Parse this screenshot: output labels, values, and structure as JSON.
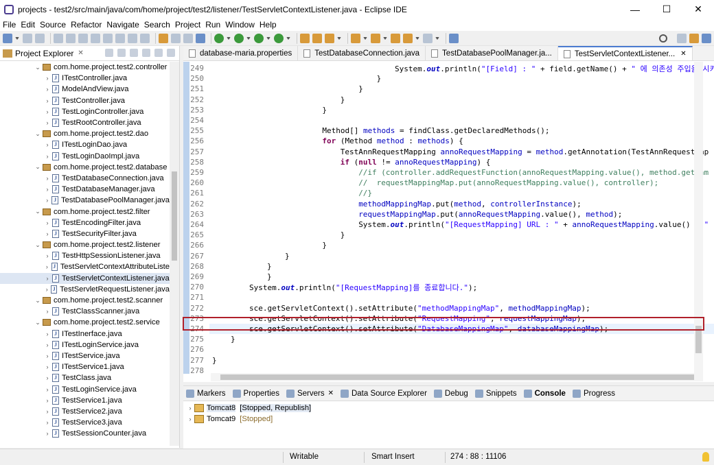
{
  "window": {
    "title": "projects - test2/src/main/java/com/home/project/test2/listener/TestServletContextListener.java - Eclipse IDE",
    "minimize": "—",
    "maximize": "☐",
    "close": "✕"
  },
  "menu": [
    "File",
    "Edit",
    "Source",
    "Refactor",
    "Navigate",
    "Search",
    "Project",
    "Run",
    "Window",
    "Help"
  ],
  "project_explorer": {
    "title": "Project Explorer",
    "close": "✕",
    "items": [
      {
        "type": "pkg",
        "label": "com.home.project.test2.controller"
      },
      {
        "type": "java",
        "label": "ITestController.java"
      },
      {
        "type": "java",
        "label": "ModelAndView.java"
      },
      {
        "type": "java",
        "label": "TestController.java"
      },
      {
        "type": "java",
        "label": "TestLoginController.java"
      },
      {
        "type": "java",
        "label": "TestRootController.java"
      },
      {
        "type": "pkg",
        "label": "com.home.project.test2.dao"
      },
      {
        "type": "java",
        "label": "ITestLoginDao.java"
      },
      {
        "type": "java",
        "label": "TestLoginDaoImpl.java"
      },
      {
        "type": "pkg",
        "label": "com.home.project.test2.database"
      },
      {
        "type": "java",
        "label": "TestDatabaseConnection.java"
      },
      {
        "type": "java",
        "label": "TestDatabaseManager.java"
      },
      {
        "type": "java",
        "label": "TestDatabasePoolManager.java"
      },
      {
        "type": "pkg",
        "label": "com.home.project.test2.filter"
      },
      {
        "type": "java",
        "label": "TestEncodingFilter.java"
      },
      {
        "type": "java",
        "label": "TestSecurityFilter.java"
      },
      {
        "type": "pkg",
        "label": "com.home.project.test2.listener"
      },
      {
        "type": "java",
        "label": "TestHttpSessionListener.java"
      },
      {
        "type": "java",
        "label": "TestServletContextAttributeListe"
      },
      {
        "type": "java",
        "label": "TestServletContextListener.java",
        "selected": true
      },
      {
        "type": "java",
        "label": "TestServletRequestListener.java"
      },
      {
        "type": "pkg",
        "label": "com.home.project.test2.scanner"
      },
      {
        "type": "java",
        "label": "TestClassScanner.java"
      },
      {
        "type": "pkg",
        "label": "com.home.project.test2.service"
      },
      {
        "type": "java",
        "label": "ITestInerface.java"
      },
      {
        "type": "java",
        "label": "ITestLoginService.java"
      },
      {
        "type": "java",
        "label": "ITestService.java"
      },
      {
        "type": "java",
        "label": "ITestService1.java"
      },
      {
        "type": "java",
        "label": "TestClass.java"
      },
      {
        "type": "java",
        "label": "TestLoginService.java"
      },
      {
        "type": "java",
        "label": "TestService1.java"
      },
      {
        "type": "java",
        "label": "TestService2.java"
      },
      {
        "type": "java",
        "label": "TestService3.java"
      },
      {
        "type": "java",
        "label": "TestSessionCounter.java"
      }
    ]
  },
  "editor_tabs": [
    {
      "label": "database-maria.properties"
    },
    {
      "label": "TestDatabaseConnection.java"
    },
    {
      "label": "TestDatabasePoolManager.ja..."
    },
    {
      "label": "TestServletContextListener...",
      "active": true,
      "close": "✕"
    }
  ],
  "code_lines": [
    {
      "n": "249",
      "html": "                    System.<span class=\"it\">out</span>.println(<span class=\"st\">\"[Field] : \"</span> + field.getName() + <span class=\"st\">\" 에 의존성 주입을 시키어\"</span>"
    },
    {
      "n": "250",
      "html": "                }"
    },
    {
      "n": "251",
      "html": "            }"
    },
    {
      "n": "252",
      "html": "        }"
    },
    {
      "n": "253",
      "html": "    }"
    },
    {
      "n": "254",
      "html": ""
    },
    {
      "n": "255",
      "html": "    Method[] <span class=\"fd\">methods</span> = findClass.getDeclaredMethods();"
    },
    {
      "n": "256",
      "html": "    <span class=\"kw\">for</span> (Method <span class=\"fd\">method</span> : <span class=\"fd\">methods</span>) {"
    },
    {
      "n": "257",
      "html": "        TestAnnRequestMapping <span class=\"fd\">annoRequestMapping</span> = <span class=\"fd\">method</span>.getAnnotation(TestAnnRequestMap"
    },
    {
      "n": "258",
      "html": "        <span class=\"kw\">if</span> (<span class=\"kw\">null</span> != <span class=\"fd\">annoRequestMapping</span>) {"
    },
    {
      "n": "259",
      "html": "            <span class=\"cm\">//if (controller.addRequestFunction(annoRequestMapping.value(), method.getNam</span>"
    },
    {
      "n": "260",
      "html": "            <span class=\"cm\">//  requestMappingMap.put(annoRequestMapping.value(), controller);</span>"
    },
    {
      "n": "261",
      "html": "            <span class=\"cm\">//}</span>"
    },
    {
      "n": "262",
      "html": "            <span class=\"fd\">methodMappingMap</span>.put(<span class=\"fd\">method</span>, <span class=\"fd\">controllerInstance</span>);"
    },
    {
      "n": "263",
      "html": "            <span class=\"fd\">requestMappingMap</span>.put(<span class=\"fd\">annoRequestMapping</span>.value(), <span class=\"fd\">method</span>);"
    },
    {
      "n": "264",
      "html": "            System.<span class=\"it\">out</span>.println(<span class=\"st\">\"[RequestMapping] URL : \"</span> + <span class=\"fd\">annoRequestMapping</span>.value() + <span class=\"st\">\"</span>"
    },
    {
      "n": "265",
      "html": "        }"
    },
    {
      "n": "266",
      "html": "    }"
    },
    {
      "n": "267",
      "html": "}"
    },
    {
      "n": "268",
      "html": "}"
    },
    {
      "n": "269",
      "html": "}"
    },
    {
      "n": "270",
      "html": "System.<span class=\"it\">out</span>.println(<span class=\"st\">\"[RequestMapping]를 종료합니다.\"</span>);"
    },
    {
      "n": "271",
      "html": ""
    },
    {
      "n": "272",
      "html": "sce.getServletContext().setAttribute(<span class=\"st\">\"methodMappingMap\"</span>, <span class=\"fd\">methodMappingMap</span>);"
    },
    {
      "n": "273",
      "html": "sce.getServletContext().setAttribute(<span class=\"st\">\"RequestMapping\"</span>, <span class=\"fd\">requestMappingMap</span>);"
    },
    {
      "n": "274",
      "html": "sce.getServletContext().setAttribute(<span class=\"st\">\"DatabaseMappingMap\"</span>, <span class=\"fd\">databaseMappingMap</span>);"
    },
    {
      "n": "275",
      "html": "}"
    },
    {
      "n": "276",
      "html": ""
    },
    {
      "n": "277",
      "html": "}"
    },
    {
      "n": "278",
      "html": ""
    }
  ],
  "bottom_tabs": [
    {
      "label": "Markers"
    },
    {
      "label": "Properties"
    },
    {
      "label": "Servers",
      "close": "✕"
    },
    {
      "label": "Data Source Explorer"
    },
    {
      "label": "Debug"
    },
    {
      "label": "Snippets"
    },
    {
      "label": "Console",
      "active": true
    },
    {
      "label": "Progress"
    }
  ],
  "servers": [
    {
      "name": "Tomcat8",
      "status": "[Stopped, Republish]",
      "selected": true
    },
    {
      "name": "Tomcat9",
      "status": "[Stopped]"
    }
  ],
  "statusbar": {
    "mode": "Writable",
    "insert": "Smart Insert",
    "position": "274 : 88 : 11106"
  }
}
